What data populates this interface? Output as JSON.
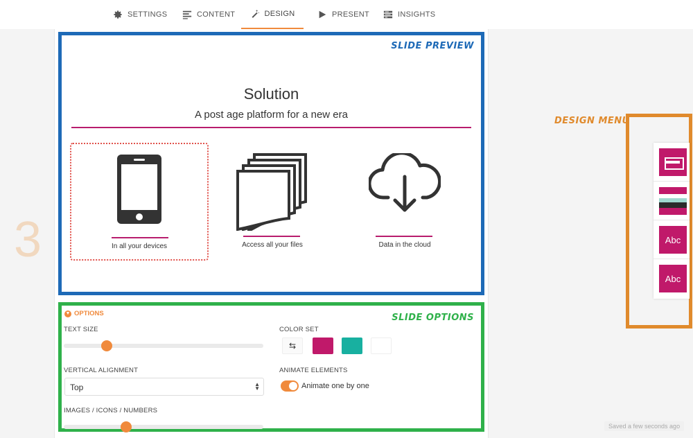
{
  "nav": {
    "tabs": [
      {
        "label": "SETTINGS",
        "icon": "gear-icon"
      },
      {
        "label": "CONTENT",
        "icon": "text-lines-icon"
      },
      {
        "label": "DESIGN",
        "icon": "magic-wand-icon",
        "active": true
      },
      {
        "label": "PRESENT",
        "icon": "play-icon"
      },
      {
        "label": "INSIGHTS",
        "icon": "chart-list-icon"
      }
    ]
  },
  "step_number": "3",
  "annotations": {
    "slide_preview": "SLIDE PREVIEW",
    "slide_options": "SLIDE OPTIONS",
    "design_menu": "DESIGN MENU"
  },
  "slide": {
    "title": "Solution",
    "subtitle": "A post age platform for a new era",
    "features": [
      {
        "label": "In all your devices",
        "icon": "smartphone-icon"
      },
      {
        "label": "Access all your files",
        "icon": "stacked-files-icon"
      },
      {
        "label": "Data in the cloud",
        "icon": "cloud-download-icon"
      }
    ],
    "accent_color": "#b81c6d"
  },
  "options": {
    "header": "OPTIONS",
    "text_size_label": "TEXT SIZE",
    "text_size_value": 0.2,
    "vertical_alignment_label": "VERTICAL ALIGNMENT",
    "vertical_alignment_value": "Top",
    "images_label": "IMAGES / ICONS / NUMBERS",
    "images_value": 0.3,
    "color_set_label": "COLOR SET",
    "color_swatches": [
      "#c0196a",
      "#18b0a0",
      "#ffffff"
    ],
    "animate_label": "ANIMATE ELEMENTS",
    "animate_toggle_label": "Animate one by one",
    "animate_on": true
  },
  "design_menu": {
    "items": [
      {
        "icon": "layout-icon"
      },
      {
        "icon": "palette-icon"
      },
      {
        "text": "Abc"
      },
      {
        "text": "Abc"
      }
    ]
  },
  "status": {
    "saved": "Saved a few seconds ago"
  }
}
